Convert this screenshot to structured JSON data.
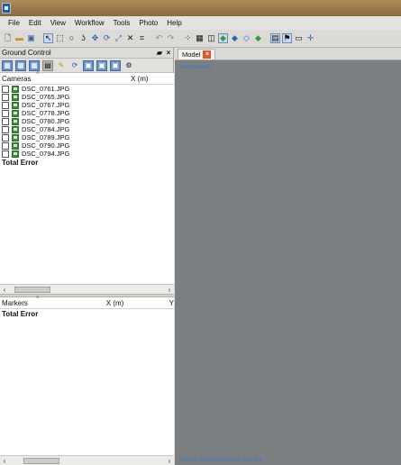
{
  "menu": [
    "File",
    "Edit",
    "View",
    "Workflow",
    "Tools",
    "Photo",
    "Help"
  ],
  "ground_control": {
    "title": "Ground Control",
    "float_icon": "float-icon",
    "close_icon": "close-icon"
  },
  "cameras": {
    "col_name": "Cameras",
    "col_x": "X (m)",
    "items": [
      {
        "label": "DSC_0761.JPG"
      },
      {
        "label": "DSC_0765.JPG"
      },
      {
        "label": "DSC_0767.JPG"
      },
      {
        "label": "DSC_0778.JPG"
      },
      {
        "label": "DSC_0780.JPG"
      },
      {
        "label": "DSC_0784.JPG"
      },
      {
        "label": "DSC_0789.JPG"
      },
      {
        "label": "DSC_0790.JPG"
      },
      {
        "label": "DSC_0794.JPG"
      }
    ],
    "total": "Total Error"
  },
  "markers": {
    "col_name": "Markers",
    "col_x": "X (m)",
    "col_y": "Y",
    "total": "Total Error"
  },
  "model": {
    "tab_label": "Model",
    "view_label": "Perspective",
    "status": "Faces: 500 043 vertices: 251 429"
  },
  "colors": {
    "viewport": "#7c7f81",
    "accent_text": "#3a78cf",
    "tab_close": "#d9582b"
  }
}
